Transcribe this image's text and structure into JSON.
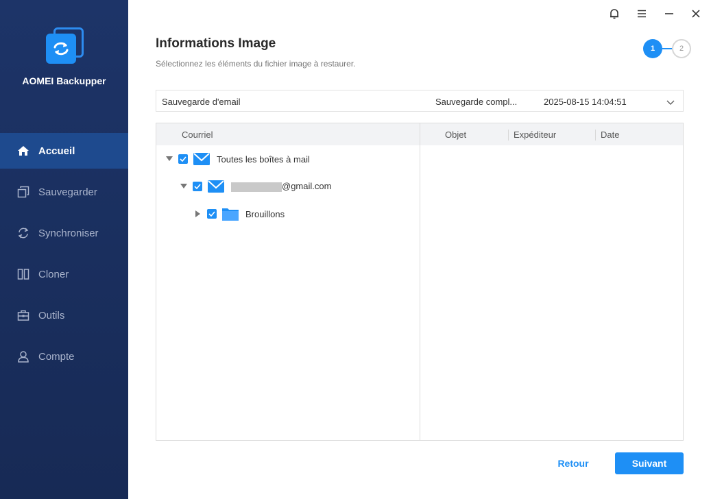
{
  "app": {
    "name": "AOMEI Backupper"
  },
  "sidebar": {
    "items": [
      {
        "label": "Accueil",
        "icon": "home-icon",
        "active": true
      },
      {
        "label": "Sauvegarder",
        "icon": "backup-icon",
        "active": false
      },
      {
        "label": "Synchroniser",
        "icon": "sync-icon",
        "active": false
      },
      {
        "label": "Cloner",
        "icon": "clone-icon",
        "active": false
      },
      {
        "label": "Outils",
        "icon": "toolbox-icon",
        "active": false
      },
      {
        "label": "Compte",
        "icon": "user-icon",
        "active": false
      }
    ]
  },
  "window_controls": [
    "bell-icon",
    "menu-icon",
    "minimize-icon",
    "close-icon"
  ],
  "header": {
    "title": "Informations Image",
    "subtitle": "Sélectionnez les éléments du fichier image à restaurer."
  },
  "steps": {
    "current": "1",
    "next": "2"
  },
  "image_select": {
    "name": "Sauvegarde d'email",
    "type": "Sauvegarde compl...",
    "datetime": "2025-08-15 14:04:51"
  },
  "tree": {
    "header": "Courriel",
    "items": [
      {
        "label": "Toutes les boîtes à mail",
        "checked": true,
        "expanded": true,
        "icon": "mail-icon"
      },
      {
        "label": "@gmail.com",
        "redacted_prefix": true,
        "checked": true,
        "expanded": true,
        "icon": "mail-icon"
      },
      {
        "label": "Brouillons",
        "checked": true,
        "expanded": false,
        "icon": "folder-icon"
      }
    ]
  },
  "messages": {
    "columns": [
      "Objet",
      "Expéditeur",
      "Date"
    ]
  },
  "footer": {
    "back_label": "Retour",
    "next_label": "Suivant"
  },
  "colors": {
    "accent": "#1e8ff5",
    "sidebar_bg": "#1d3468",
    "sidebar_active": "#1e4a8e"
  }
}
